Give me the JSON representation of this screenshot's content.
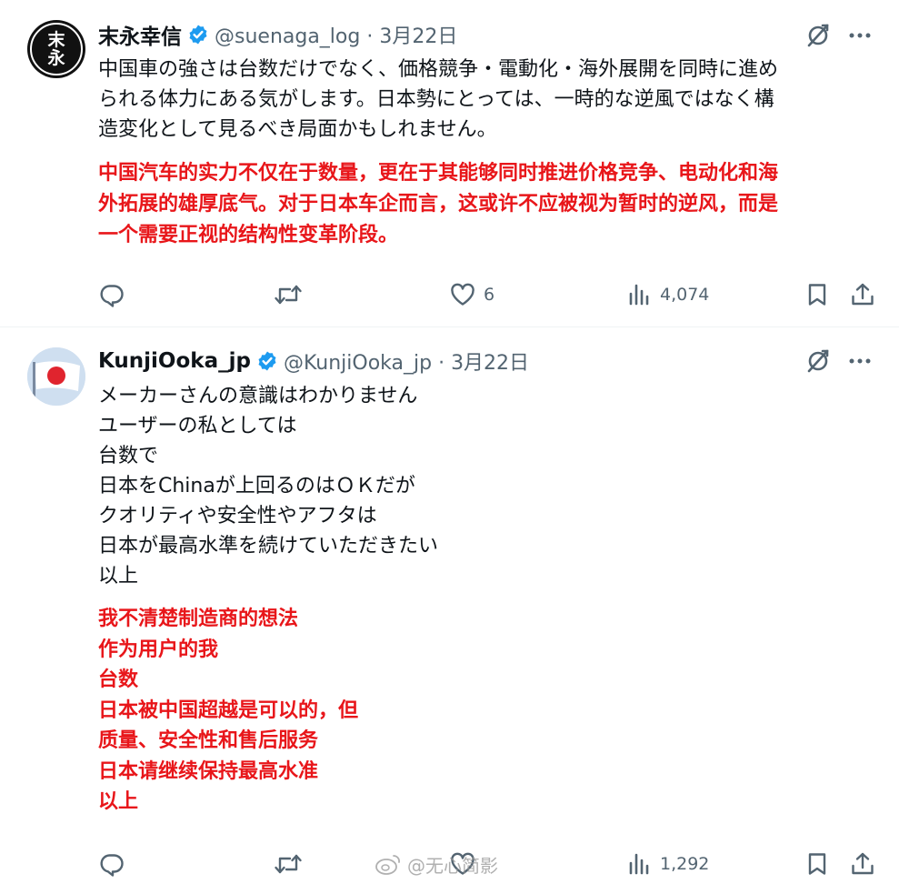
{
  "tweets": [
    {
      "display_name": "末永幸信",
      "handle_time": "@suenaga_log · 3月22日",
      "avatar_text_top": "末",
      "avatar_text_bottom": "永",
      "body": "中国車の強さは台数だけでなく、価格競争・電動化・海外展開を同時に進め\nられる体力にある気がします。日本勢にとっては、一時的な逆風ではなく構\n造変化として見るべき局面かもしれません。",
      "translation": "中国汽车的实力不仅在于数量，更在于其能够同时推进价格竞争、电动化和海\n外拓展的雄厚底气。对于日本车企而言，这或许不应被视为暂时的逆风，而是\n一个需要正视的结构性变革阶段。",
      "likes": "6",
      "views": "4,074"
    },
    {
      "display_name": "KunjiOoka_jp",
      "handle_time": "@KunjiOoka_jp · 3月22日",
      "body": "メーカーさんの意識はわかりません\nユーザーの私としては\n台数で\n日本をChinaが上回るのはＯＫだが\nクオリティや安全性やアフタは\n日本が最高水準を続けていただきたい\n以上",
      "translation": "我不清楚制造商的想法\n作为用户的我\n台数\n日本被中国超越是可以的，但\n质量、安全性和售后服务\n日本请继续保持最高水准\n以上",
      "likes": "",
      "views": "1,292"
    }
  ],
  "watermark": "@无心简影",
  "colors": {
    "text": "#0f1419",
    "secondary": "#536471",
    "verified": "#1d9bf0",
    "translation": "#e8161a",
    "divider": "#eff3f4"
  },
  "icons": [
    "verified-badge-icon",
    "grok-icon",
    "more-icon",
    "reply-icon",
    "retweet-icon",
    "like-icon",
    "views-icon",
    "bookmark-icon",
    "share-icon",
    "weibo-logo-icon"
  ]
}
